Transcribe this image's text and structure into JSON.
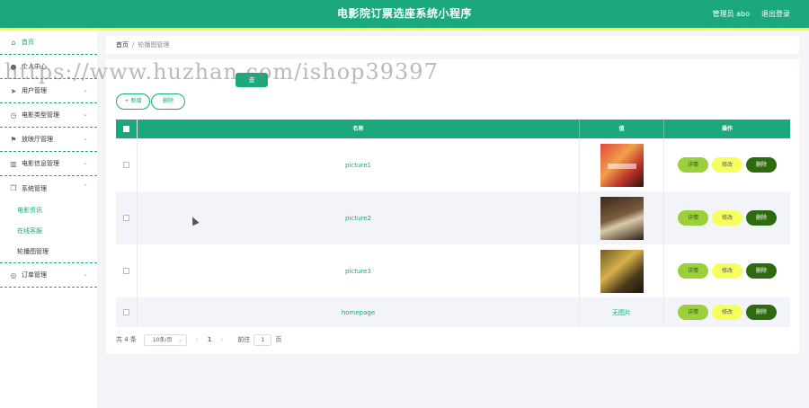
{
  "header": {
    "title": "电影院订票选座系统小程序",
    "user": "管理员 abo",
    "logout": "退出登录"
  },
  "sidebar": {
    "items": [
      {
        "label": "首页",
        "icon": "home-icon"
      },
      {
        "label": "个人中心",
        "icon": "user-icon"
      },
      {
        "label": "用户管理",
        "icon": "send-icon"
      },
      {
        "label": "电影类型管理",
        "icon": "clock-icon"
      },
      {
        "label": "放映厅管理",
        "icon": "flag-icon"
      },
      {
        "label": "电影信息管理",
        "icon": "trash-icon"
      },
      {
        "label": "系统管理",
        "icon": "copy-icon"
      }
    ],
    "sub_items": [
      {
        "label": "电影资讯"
      },
      {
        "label": "在线客服"
      },
      {
        "label": "轮播图管理"
      }
    ],
    "last_item": {
      "label": "订单管理",
      "icon": "globe-icon"
    }
  },
  "breadcrumb": {
    "home": "首页",
    "separator": "/",
    "current": "轮播图管理"
  },
  "toolbar": {
    "search_label": "查",
    "add_label": "+ 新增",
    "delete_label": "删除"
  },
  "table": {
    "headers": {
      "name": "名称",
      "value": "值",
      "ops": "操作"
    },
    "rows": [
      {
        "name": "picture1",
        "has_image": true
      },
      {
        "name": "picture2",
        "has_image": true
      },
      {
        "name": "picture3",
        "has_image": true
      },
      {
        "name": "homepage",
        "has_image": false,
        "value_text": "无图片"
      }
    ],
    "op_labels": {
      "detail": "详情",
      "edit": "修改",
      "delete": "删除"
    }
  },
  "pager": {
    "total": "共 4 条",
    "page_size": "10条/页",
    "current_page": "1",
    "goto_label": "前往",
    "goto_value": "1",
    "goto_suffix": "页"
  },
  "watermark": "https://www.huzhan.com/ishop39397",
  "colors": {
    "primary": "#1aa87c",
    "accent_stripe": "#f6ff3a",
    "detail_btn": "#9cd03a",
    "edit_btn": "#f6ff60",
    "delete_btn": "#2e6a10"
  }
}
